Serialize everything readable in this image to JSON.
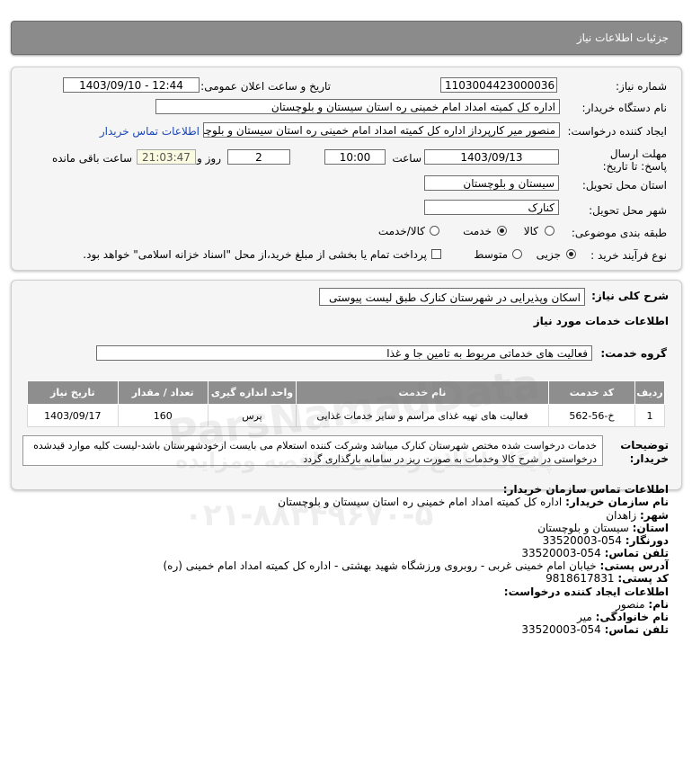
{
  "header": {
    "title": "جزئیات اطلاعات نیاز"
  },
  "need": {
    "number_label": "شماره نیاز:",
    "number": "1103004423000036",
    "announce_label": "تاریخ و ساعت اعلان عمومی:",
    "announce": "1403/09/10 - 12:44",
    "buyer_label": "نام دستگاه خریدار:",
    "buyer": "اداره کل کمیته امداد امام خمینی  ره  استان سیستان و بلوچستان",
    "creator_label": "ایجاد کننده درخواست:",
    "creator": "منصور میر کارپرداز اداره کل کمیته امداد امام خمینی  ره  استان سیستان و بلوچستان",
    "contact_link": "اطلاعات تماس خریدار",
    "deadline_label": "مهلت ارسال پاسخ: تا تاریخ:",
    "deadline_date": "1403/09/13",
    "time_label": "ساعت",
    "deadline_time": "10:00",
    "days": "2",
    "days_label": "روز و",
    "remaining_time": "21:03:47",
    "remaining_label": "ساعت باقی مانده",
    "province_label": "استان محل تحویل:",
    "province": "سیستان و بلوچستان",
    "city_label": "شهر محل تحویل:",
    "city": "کنارک",
    "category_label": "طبقه بندی موضوعی:",
    "category_options": [
      "کالا",
      "خدمت",
      "کالا/خدمت"
    ],
    "category_selected": "خدمت",
    "process_label": "نوع فرآیند خرید :",
    "process_options": [
      "جزیی",
      "متوسط"
    ],
    "process_selected": "جزیی",
    "payment_text": "پرداخت تمام یا بخشی از مبلغ خرید،از محل \"اسناد خزانه اسلامی\" خواهد بود."
  },
  "summary": {
    "label": "شرح کلی نیاز:",
    "value": "اسکان وپذیرایی در شهرستان کنارک طبق لیست پیوستی",
    "services_title": "اطلاعات خدمات مورد نیاز",
    "group_label": "گروه خدمت:",
    "group_value": "فعالیت های خدماتی مربوط به تامین جا و غذا"
  },
  "table": {
    "headers": [
      "ردیف",
      "کد خدمت",
      "نام خدمت",
      "واحد اندازه گیری",
      "تعداد / مقدار",
      "تاریخ نیاز"
    ],
    "rows": [
      [
        "1",
        "خ-56-562",
        "فعالیت های تهیه غذای مراسم و سایر خدمات غذایی",
        "پرس",
        "160",
        "1403/09/17"
      ]
    ]
  },
  "description": {
    "label": "توضیحات خریدار:",
    "text": "خدمات درخواست شده مختص شهرستان کنارک میباشد وشرکت کننده استعلام می بایست ازخودشهرستان باشد-لیست کلیه موارد قیدشده درخواستی در شرح کالا وخدمات به صورت ریز در سامانه بارگذاری گردد"
  },
  "buyer_contact": {
    "title": "اطلاعات تماس سازمان خریدار:",
    "org_label": "نام سازمان خریدار:",
    "org": "اداره کل کمیته امداد امام خمینی ره استان سیستان و بلوچستان",
    "city_label": "شهر:",
    "city": "زاهدان",
    "province_label": "استان:",
    "province": "سیستان و بلوچستان",
    "fax_label": "دورنگار:",
    "fax": "054-33520003",
    "phone_label": "تلفن تماس:",
    "phone": "054-33520003",
    "address_label": "آدرس پستی:",
    "address": "خیابان امام خمینی غربی - روبروی ورزشگاه شهید بهشتی - اداره کل کمیته امداد امام خمینی (ره)",
    "postal_label": "کد پستی:",
    "postal": "9818617831"
  },
  "creator_contact": {
    "title": "اطلاعات ایجاد کننده درخواست:",
    "name_label": "نام:",
    "name": "منصور",
    "family_label": "نام خانوادگی:",
    "family": "میر",
    "phone_label": "تلفن تماس:",
    "phone": "054-33520003"
  },
  "watermark": {
    "brand": "ParsNamadData",
    "tagline": "پایگاه اطلاع رسانی مناقصه ومزایده",
    "phone": "۰۲۱-۸۸۳۴۹۶۷۰-۵"
  },
  "colors": {
    "header_bg": "#8b8b8b",
    "link": "#1a46b8",
    "table_header": "#8e8e8e"
  }
}
